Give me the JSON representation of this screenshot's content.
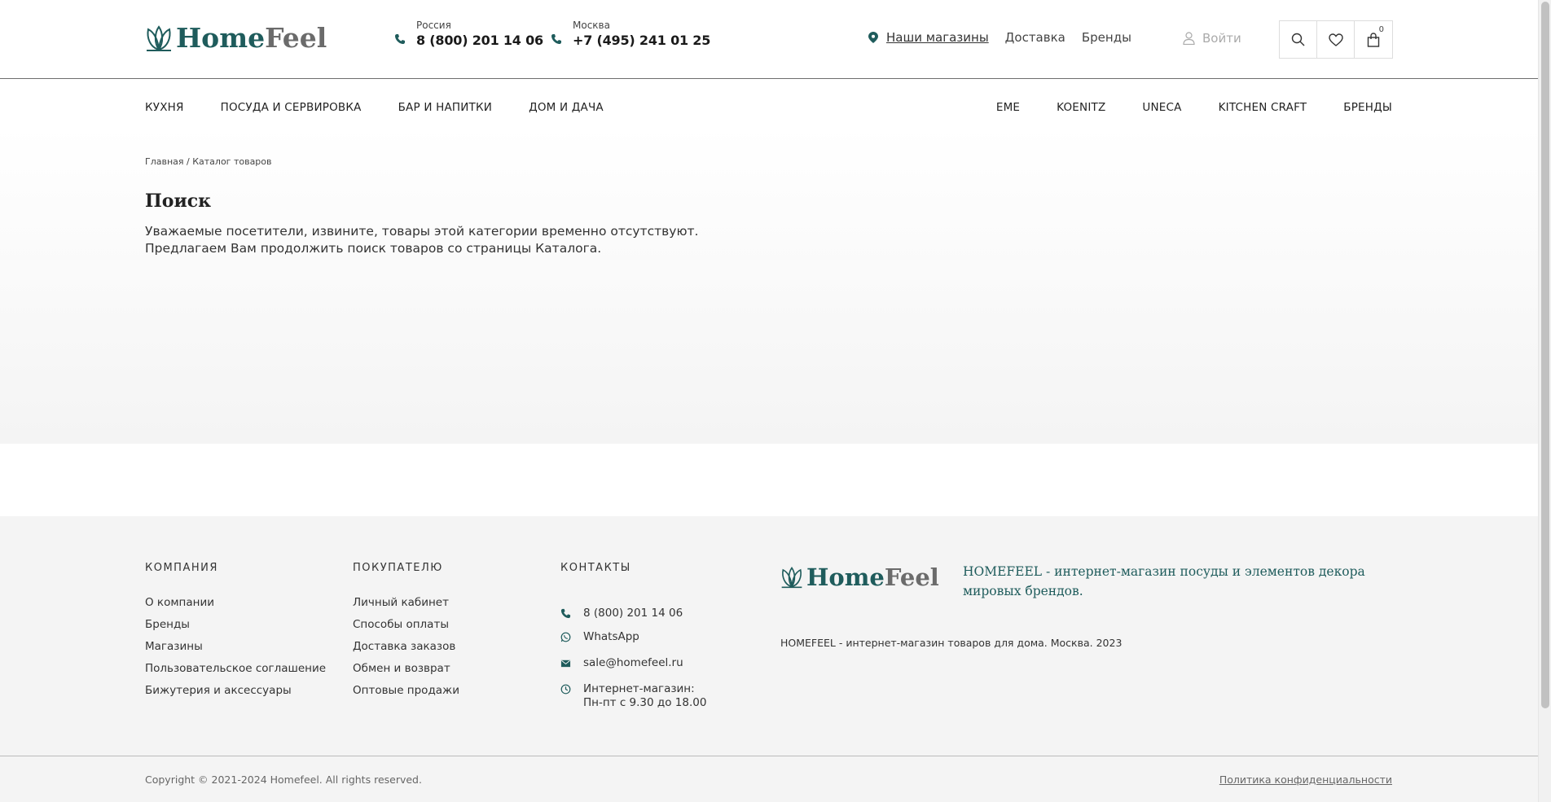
{
  "header": {
    "logo": {
      "home": "Home",
      "feel": "Feel"
    },
    "phones": [
      {
        "region": "Россия",
        "number": "8 (800) 201 14 06"
      },
      {
        "region": "Москва",
        "number": "+7 (495) 241 01 25"
      }
    ],
    "links": {
      "stores": "Наши магазины",
      "delivery": "Доставка",
      "brands": "Бренды"
    },
    "login": "Войти",
    "cart_count": "0"
  },
  "nav": {
    "left": [
      "КУХНЯ",
      "ПОСУДА И СЕРВИРОВКА",
      "БАР И НАПИТКИ",
      "ДОМ И ДАЧА"
    ],
    "right": [
      "EME",
      "KOENITZ",
      "UNECA",
      "KITCHEN CRAFT",
      "БРЕНДЫ"
    ]
  },
  "breadcrumb": "Главная / Каталог товаров",
  "main": {
    "title": "Поиск",
    "line1": "Уважаемые посетители, извините, товары этой категории временно отсутствуют.",
    "line2": "Предлагаем Вам продолжить поиск товаров со страницы Каталога."
  },
  "footer": {
    "company": {
      "heading": "КОМПАНИЯ",
      "items": [
        "О компании",
        "Бренды",
        "Магазины",
        "Пользовательское соглашение",
        "Бижутерия и аксессуары"
      ]
    },
    "buyer": {
      "heading": "ПОКУПАТЕЛЮ",
      "items": [
        "Личный кабинет",
        "Способы оплаты",
        "Доставка заказов",
        "Обмен и возврат",
        "Оптовые продажи"
      ]
    },
    "contacts": {
      "heading": "КОНТАКТЫ",
      "phone": "8 (800) 201 14 06",
      "whatsapp": "WhatsApp",
      "email": "sale@homefeel.ru",
      "hours_line1": "Интернет-магазин:",
      "hours_line2": "Пн-пт с 9.30 до 18.00"
    },
    "description": "HOMEFEEL - интернет-магазин посуды и элементов декора мировых брендов.",
    "small": "HOMEFEEL - интернет-магазин товаров для дома. Москва. 2023",
    "copyright": "Copyright © 2021-2024 Homefeel. All rights reserved.",
    "policy": "Политика конфиденциальности"
  },
  "colors": {
    "brand": "#1f5c5c",
    "logo_gray": "#6b6b6b",
    "footer_bg": "#f4f4f4"
  }
}
